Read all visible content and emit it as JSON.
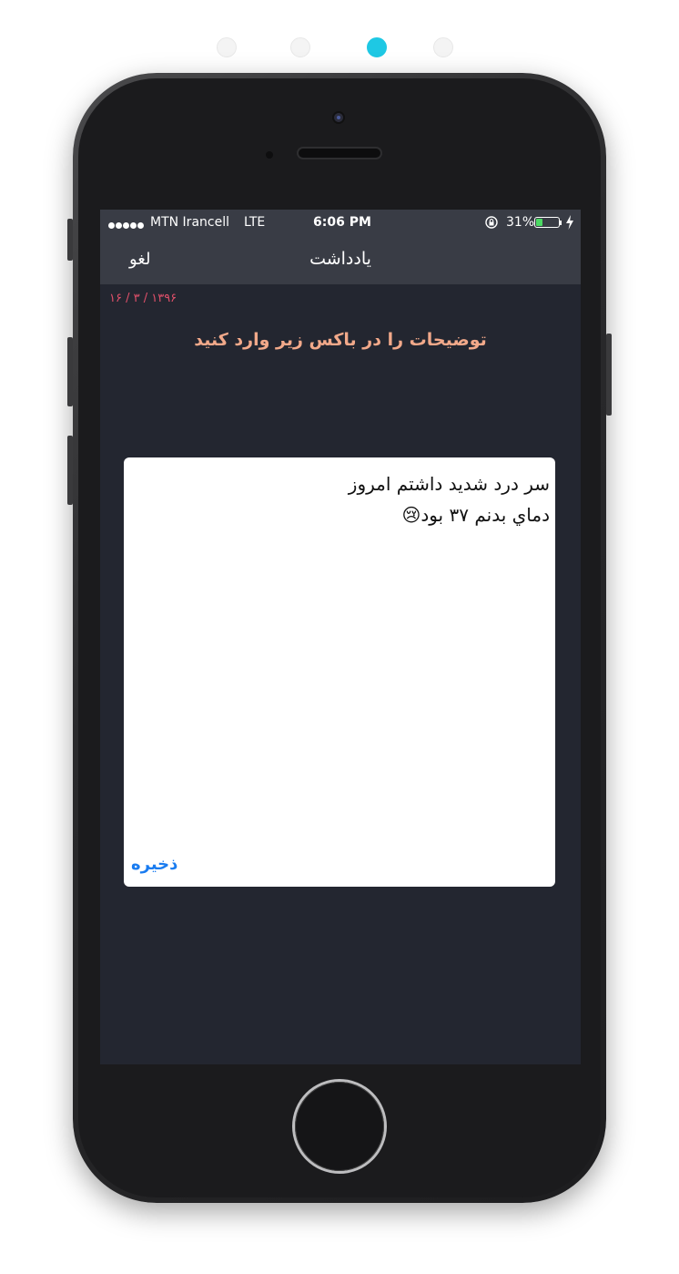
{
  "pager": {
    "count": 4,
    "active_index": 2,
    "active_color": "#1ec8e4"
  },
  "status_bar": {
    "carrier": "MTN Irancell",
    "network": "LTE",
    "time": "6:06 PM",
    "battery_percent": "31%",
    "battery_level": 0.31,
    "icons": [
      "signal-dots-icon",
      "rotation-lock-icon",
      "battery-icon",
      "charging-bolt-icon"
    ]
  },
  "nav": {
    "title": "یادداشت",
    "cancel_label": "لغو"
  },
  "content": {
    "date": "۱۶ / ۳ / ۱۳۹۶",
    "instruction": "توضیحات را در باکس زیر وارد کنید",
    "note_text": "سر درد شديد داشتم امروز\nدماي بدنم ۳۷ بود😢",
    "save_label": "ذخیره"
  },
  "colors": {
    "screen_bg": "#232630",
    "navbar_bg": "#393c45",
    "date": "#e0506a",
    "instruction": "#f2a98a",
    "save": "#1a7cf0"
  }
}
